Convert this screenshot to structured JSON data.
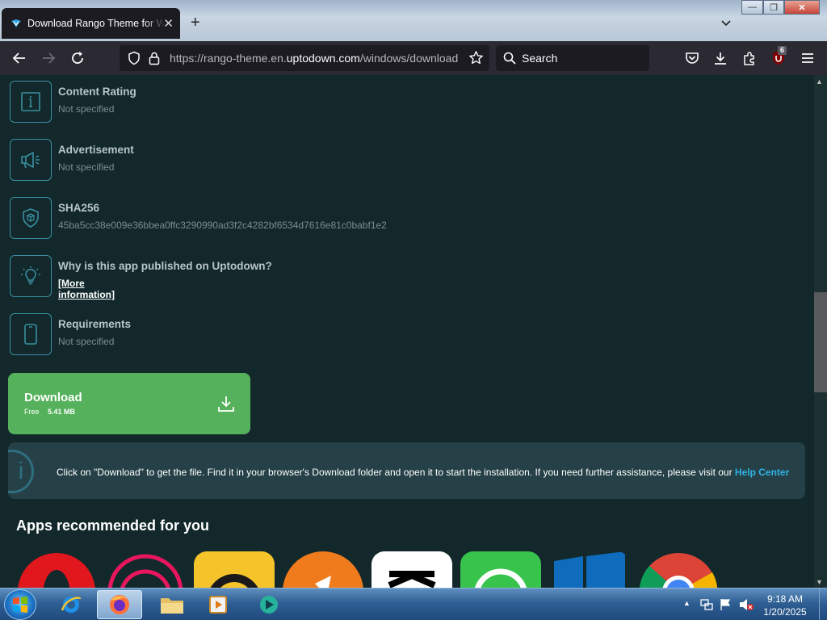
{
  "browser": {
    "tab_title": "Download Rango Theme for Windows",
    "tab_close": "✕",
    "new_tab": "+",
    "url_prefix": "https://rango-theme.en.",
    "url_domain": "uptodown.com",
    "url_suffix": "/windows/download",
    "search_placeholder": "Search",
    "extension_badge": "6"
  },
  "info_items": [
    {
      "title": "Content Rating",
      "value": "Not specified",
      "icon": "info-icon"
    },
    {
      "title": "Advertisement",
      "value": "Not specified",
      "icon": "megaphone-icon"
    },
    {
      "title": "SHA256",
      "value": "45ba5cc38e009e36bbea0ffc3290990ad3f2c4282bf6534d7616e81c0babf1e2",
      "icon": "shield-cube-icon"
    },
    {
      "title": "Why is this app published on Uptodown?",
      "value": "",
      "icon": "lightbulb-icon"
    },
    {
      "title": "Requirements",
      "value": "Not specified",
      "icon": "phone-icon"
    }
  ],
  "more_info_link": "[More information]",
  "download": {
    "label": "Download",
    "free": "Free",
    "size": "5.41 MB"
  },
  "notice": {
    "text": "Click on \"Download\" to get the file. Find it in your browser's Download folder and open it to start the installation. If you need further assistance, please visit our ",
    "link": "Help Center"
  },
  "recommended_title": "Apps recommended for you",
  "recommended_apps": [
    "opera-icon",
    "opera-gx-icon",
    "slack-like-icon",
    "orange-app-icon",
    "capcut-icon",
    "whatsapp-icon",
    "windows-icon",
    "chrome-icon"
  ],
  "taskbar": {
    "time": "9:18 AM",
    "date": "1/20/2025"
  },
  "colors": {
    "page_bg": "#12282b",
    "download_green": "#55b15b",
    "link_blue": "#2fb3e6",
    "icon_border": "#3a8fa0"
  }
}
